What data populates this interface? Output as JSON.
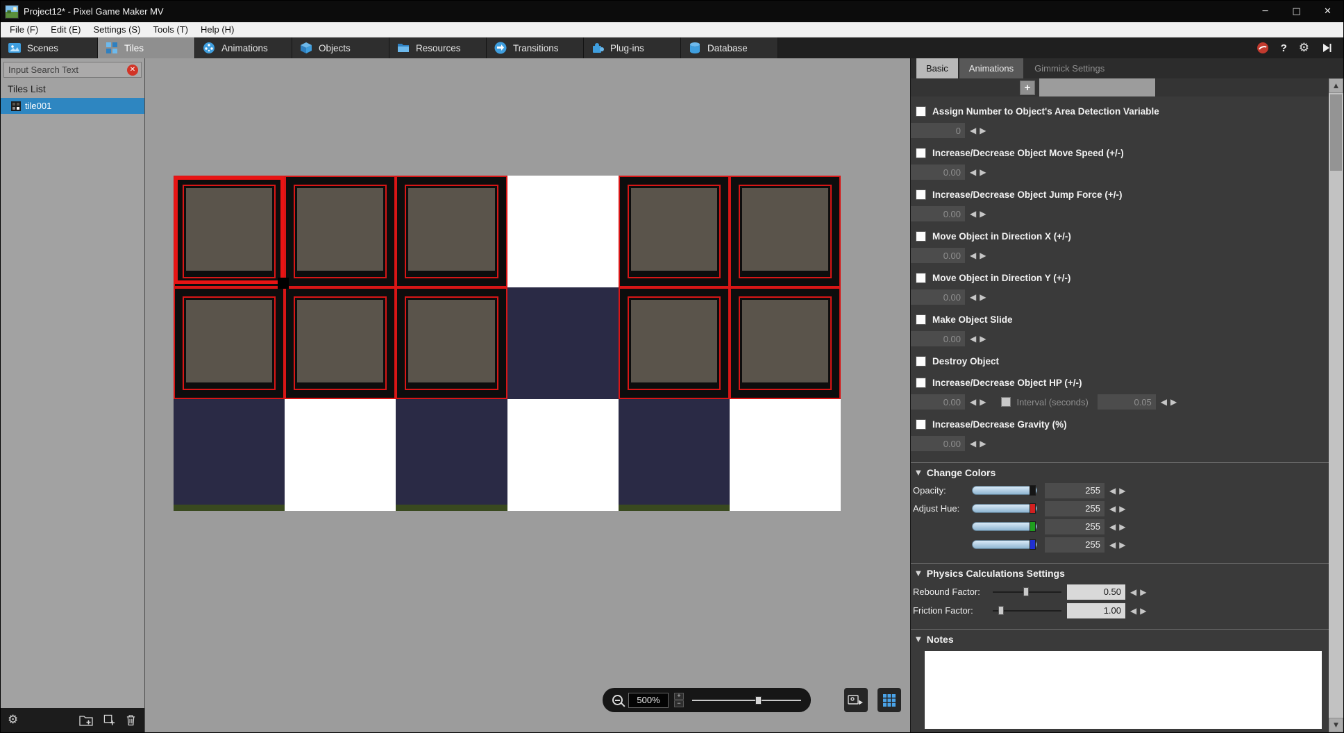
{
  "window": {
    "title": "Project12* - Pixel Game Maker MV",
    "controls": {
      "minimize": "─",
      "maximize": "□",
      "close": "✕"
    }
  },
  "menu": {
    "items": [
      "File (F)",
      "Edit (E)",
      "Settings (S)",
      "Tools (T)",
      "Help (H)"
    ]
  },
  "main_tabs": [
    {
      "label": "Scenes"
    },
    {
      "label": "Tiles"
    },
    {
      "label": "Animations"
    },
    {
      "label": "Objects"
    },
    {
      "label": "Resources"
    },
    {
      "label": "Transitions"
    },
    {
      "label": "Plug-ins"
    },
    {
      "label": "Database"
    }
  ],
  "sidebar": {
    "search_placeholder": "Input Search Text",
    "list_title": "Tiles List",
    "items": [
      {
        "label": "tile001"
      }
    ]
  },
  "canvas": {
    "zoom_value": "500%",
    "tileset": {
      "grid": [
        [
          "block",
          "block",
          "block",
          "white",
          "block",
          "block"
        ],
        [
          "block",
          "block",
          "block",
          "navy",
          "block",
          "block"
        ],
        [
          "navy-g",
          "white",
          "navy-g",
          "white",
          "navy-g",
          "white"
        ]
      ]
    }
  },
  "panel": {
    "tabs": [
      {
        "label": "Basic"
      },
      {
        "label": "Animations"
      },
      {
        "label": "Gimmick Settings"
      }
    ],
    "actions": [
      {
        "label": "Assign Number to Object's Area Detection Variable",
        "value": "0"
      },
      {
        "label": "Increase/Decrease Object Move Speed (+/-)",
        "value": "0.00"
      },
      {
        "label": "Increase/Decrease Object Jump Force (+/-)",
        "value": "0.00"
      },
      {
        "label": "Move Object in Direction X (+/-)",
        "value": "0.00"
      },
      {
        "label": "Move Object in Direction Y (+/-)",
        "value": "0.00"
      },
      {
        "label": "Make Object Slide",
        "value": "0.00"
      },
      {
        "label": "Destroy Object"
      },
      {
        "label": "Increase/Decrease Object HP (+/-)",
        "value": "0.00",
        "interval_label": "Interval (seconds)",
        "interval_value": "0.05"
      },
      {
        "label": "Increase/Decrease Gravity (%)",
        "value": "0.00"
      }
    ],
    "change_colors": {
      "title": "Change Colors",
      "opacity_label": "Opacity:",
      "hue_label": "Adjust Hue:",
      "values": [
        "255",
        "255",
        "255",
        "255"
      ],
      "handle_colors": [
        "#151515",
        "#d32020",
        "#1f9e1f",
        "#2030d0"
      ]
    },
    "physics": {
      "title": "Physics Calculations Settings",
      "rows": [
        {
          "label": "Rebound Factor:",
          "value": "0.50"
        },
        {
          "label": "Friction Factor:",
          "value": "1.00"
        }
      ]
    },
    "notes": {
      "title": "Notes",
      "content": ""
    }
  },
  "icons": {
    "left": "◀",
    "right": "▶",
    "up": "▲",
    "down": "▼",
    "plus": "+",
    "minus": "−",
    "help": "?",
    "gear": "⚙",
    "clear": "✕"
  },
  "colors": {
    "selection_blue": "#2e86c1",
    "grid_red": "#d81616",
    "tab_icon_blue": "#3f9ede"
  }
}
